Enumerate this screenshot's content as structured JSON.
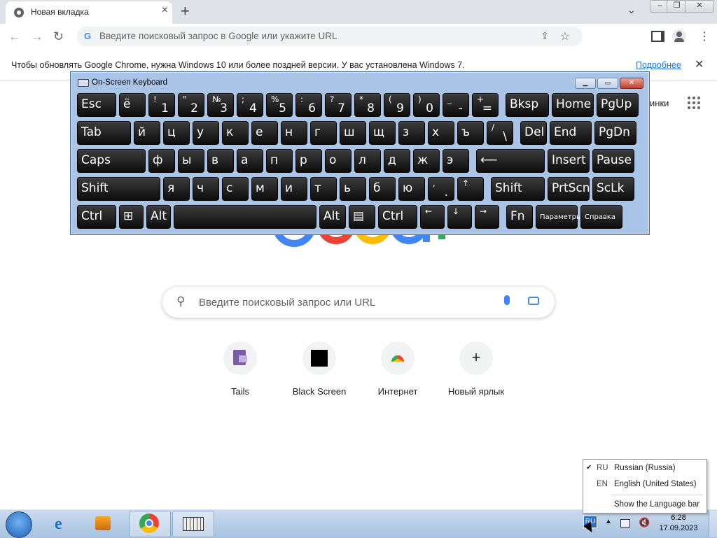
{
  "browser": {
    "tab_title": "Новая вкладка",
    "omnibox_placeholder": "Введите поисковый запрос в Google или укажите URL",
    "infobar_message": "Чтобы обновлять Google Chrome, нужна Windows 10 или более поздней версии. У вас установлена Windows 7.",
    "infobar_link": "Подробнее"
  },
  "ntp": {
    "links_text": "инки",
    "search_placeholder": "Введите поисковый запрос или URL",
    "shortcuts": [
      {
        "label": "Tails",
        "icon": "tails-icon"
      },
      {
        "label": "Black Screen",
        "icon": "black-square-icon"
      },
      {
        "label": "Интернет",
        "icon": "chrome-icon"
      },
      {
        "label": "Новый ярлык",
        "icon": "plus-icon"
      }
    ]
  },
  "osk": {
    "title": "On-Screen Keyboard",
    "rows": [
      [
        {
          "m": "Esc",
          "w": 58
        },
        {
          "m": "ё",
          "w": 40
        },
        {
          "s": "!",
          "b": "1",
          "w": 40
        },
        {
          "s": "\"",
          "b": "2",
          "w": 40
        },
        {
          "s": "№",
          "b": "3",
          "w": 40
        },
        {
          "s": ";",
          "b": "4",
          "w": 40
        },
        {
          "s": "%",
          "b": "5",
          "w": 40
        },
        {
          "s": ":",
          "b": "6",
          "w": 40
        },
        {
          "s": "?",
          "b": "7",
          "w": 40
        },
        {
          "s": "*",
          "b": "8",
          "w": 40
        },
        {
          "s": "(",
          "b": "9",
          "w": 40
        },
        {
          "s": ")",
          "b": "0",
          "w": 40
        },
        {
          "s": "_",
          "b": "-",
          "w": 40
        },
        {
          "s": "+",
          "b": "=",
          "w": 40
        },
        {
          "m": "Bksp",
          "w": 64,
          "gap": 6
        },
        {
          "m": "Home",
          "w": 62
        },
        {
          "m": "PgUp",
          "w": 62
        }
      ],
      [
        {
          "m": "Tab",
          "w": 79
        },
        {
          "m": "й",
          "w": 40
        },
        {
          "m": "ц",
          "w": 40
        },
        {
          "m": "у",
          "w": 40
        },
        {
          "m": "к",
          "w": 40
        },
        {
          "m": "е",
          "w": 40
        },
        {
          "m": "н",
          "w": 40
        },
        {
          "m": "г",
          "w": 40
        },
        {
          "m": "ш",
          "w": 40
        },
        {
          "m": "щ",
          "w": 40
        },
        {
          "m": "з",
          "w": 40
        },
        {
          "m": "х",
          "w": 40
        },
        {
          "m": "ъ",
          "w": 40
        },
        {
          "s": "/",
          "b": "\\",
          "w": 40
        },
        {
          "m": "Del",
          "w": 40,
          "gap": 6
        },
        {
          "m": "End",
          "w": 62
        },
        {
          "m": "PgDn",
          "w": 62
        }
      ],
      [
        {
          "m": "Caps",
          "w": 100
        },
        {
          "m": "ф",
          "w": 40
        },
        {
          "m": "ы",
          "w": 40
        },
        {
          "m": "в",
          "w": 40
        },
        {
          "m": "а",
          "w": 40
        },
        {
          "m": "п",
          "w": 40
        },
        {
          "m": "р",
          "w": 40
        },
        {
          "m": "о",
          "w": 40
        },
        {
          "m": "л",
          "w": 40
        },
        {
          "m": "д",
          "w": 40
        },
        {
          "m": "ж",
          "w": 40
        },
        {
          "m": "э",
          "w": 40
        },
        {
          "m": "⟵",
          "w": 100,
          "gap": 6
        },
        {
          "m": "Insert",
          "w": 62
        },
        {
          "m": "Pause",
          "w": 62
        }
      ],
      [
        {
          "m": "Shift",
          "w": 121
        },
        {
          "m": "я",
          "w": 40
        },
        {
          "m": "ч",
          "w": 40
        },
        {
          "m": "с",
          "w": 40
        },
        {
          "m": "м",
          "w": 40
        },
        {
          "m": "и",
          "w": 40
        },
        {
          "m": "т",
          "w": 40
        },
        {
          "m": "ь",
          "w": 40
        },
        {
          "m": "б",
          "w": 40
        },
        {
          "m": "ю",
          "w": 40
        },
        {
          "s": ",",
          "b": ".",
          "w": 40
        },
        {
          "s": "↑",
          "w": 40
        },
        {
          "m": "Shift",
          "w": 79,
          "gap": 6
        },
        {
          "m": "PrtScn",
          "w": 62
        },
        {
          "m": "ScLk",
          "w": 62
        }
      ],
      [
        {
          "m": "Ctrl",
          "w": 58
        },
        {
          "m": "⊞",
          "w": 37
        },
        {
          "m": "Alt",
          "w": 37
        },
        {
          "m": "",
          "w": 206
        },
        {
          "m": "Alt",
          "w": 40
        },
        {
          "m": "▤",
          "w": 40
        },
        {
          "m": "Ctrl",
          "w": 58
        },
        {
          "s": "←",
          "w": 37
        },
        {
          "s": "↓",
          "w": 37
        },
        {
          "s": "→",
          "w": 37
        },
        {
          "m": "Fn",
          "w": 40,
          "gap": 6
        },
        {
          "m": "Параметры",
          "w": 62,
          "small": true
        },
        {
          "m": "Справка",
          "w": 62,
          "small": true
        }
      ]
    ]
  },
  "language_menu": [
    {
      "code": "RU",
      "name": "Russian (Russia)",
      "checked": true
    },
    {
      "code": "EN",
      "name": "English (United States)",
      "checked": false
    }
  ],
  "language_bar_option": "Show the Language bar",
  "tray": {
    "lang": "RU",
    "time": "6:28",
    "date": "17.09.2023"
  }
}
